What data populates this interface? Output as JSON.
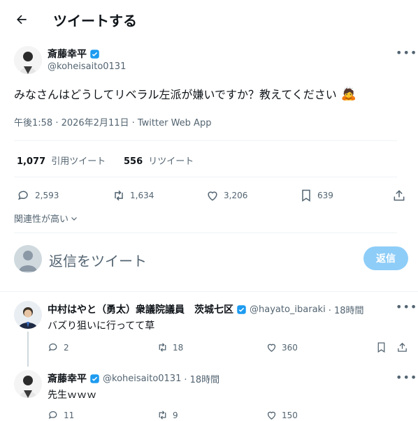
{
  "header": {
    "title": "ツイートする"
  },
  "tweet": {
    "author_name": "斎藤幸平",
    "author_handle": "@koheisaito0131",
    "text": "みなさんはどうしてリベラル左派が嫌いですか？教えてください",
    "emoji": "🙇",
    "timestamp": "午後1:58 · 2026年2月11日 · Twitter Web App",
    "stats": {
      "quote_count": "1,077",
      "quote_label": "引用ツイート",
      "retweet_count": "556",
      "retweet_label": "リツイート"
    },
    "actions": {
      "replies": "2,593",
      "retweets": "1,634",
      "likes": "3,206",
      "bookmarks": "639"
    }
  },
  "sort": {
    "label": "関連性が高い"
  },
  "compose": {
    "placeholder": "返信をツイート",
    "button_label": "返信"
  },
  "replies": [
    {
      "author_name": "中村はやと（勇太）衆議院議員　茨城七区",
      "author_handle": "@hayato_ibaraki",
      "time": "· 18時間",
      "text": "バズり狙いに行ってて草",
      "replies": "2",
      "retweets": "18",
      "likes": "360"
    },
    {
      "author_name": "斎藤幸平",
      "author_handle": "@koheisaito0131",
      "time": "· 18時間",
      "text": "先生ｗｗｗ",
      "replies": "11",
      "retweets": "9",
      "likes": "150"
    }
  ],
  "colors": {
    "accent": "#1d9bf0",
    "accent_disabled": "#8ecdf8",
    "muted": "#536471"
  }
}
